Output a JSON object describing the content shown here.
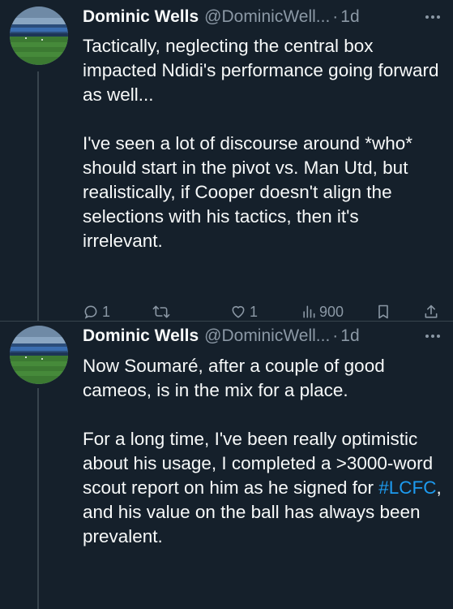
{
  "tweets": [
    {
      "author_name": "Dominic Wells",
      "handle": "@DominicWell...",
      "separator": "·",
      "time": "1d",
      "paragraphs": [
        "Tactically, neglecting the central box impacted Ndidi's performance going forward as well...",
        "I've seen a lot of discourse around *who* should start in the pivot vs. Man Utd, but realistically, if Cooper doesn't align the selections with his tactics, then it's irrelevant."
      ],
      "reply_count": "1",
      "retweet_count": "",
      "like_count": "1",
      "view_count": "900"
    },
    {
      "author_name": "Dominic Wells",
      "handle": "@DominicWell...",
      "separator": "·",
      "time": "1d",
      "paragraphs": [
        "Now Soumaré, after a couple of good cameos, is in the mix for a place."
      ],
      "p2_before": "For a long time, I've been really optimistic about his usage, I completed a >3000-word scout report on him as he signed for ",
      "p2_hashtag": "#LCFC",
      "p2_after": ", and his value on the ball has always been prevalent."
    }
  ],
  "colors": {
    "background": "#15202b",
    "text": "#f7f9f9",
    "secondary": "#8b98a5",
    "link": "#1d9bf0",
    "divider": "#38444d"
  },
  "icons": [
    "reply-icon",
    "retweet-icon",
    "like-icon",
    "views-icon",
    "bookmark-icon",
    "share-icon",
    "more-icon"
  ]
}
